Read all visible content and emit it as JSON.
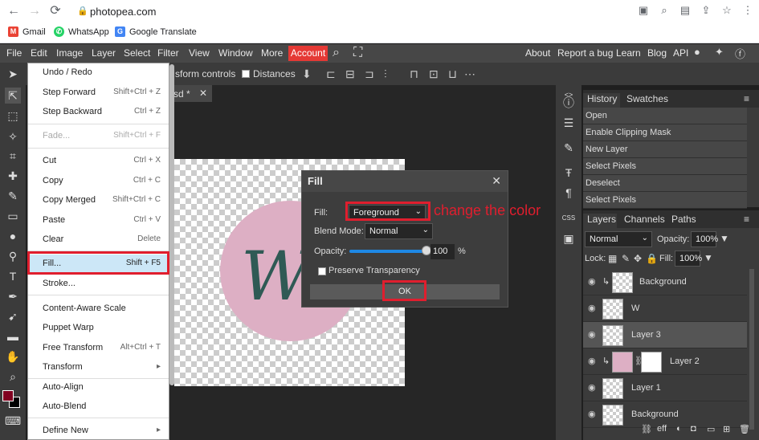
{
  "browser": {
    "url": "photopea.com",
    "bookmarks": [
      {
        "label": "Gmail",
        "icon": "gmail-icon"
      },
      {
        "label": "WhatsApp",
        "icon": "whatsapp-icon"
      },
      {
        "label": "Google Translate",
        "icon": "translate-icon"
      }
    ]
  },
  "menubar": {
    "items": [
      "File",
      "Edit",
      "Image",
      "Layer",
      "Select",
      "Filter",
      "View",
      "Window",
      "More"
    ],
    "account": "Account",
    "right_links": [
      "About",
      "Report a bug",
      "Learn",
      "Blog",
      "API"
    ]
  },
  "options": {
    "transform_controls": "sform controls",
    "distances": "Distances"
  },
  "doc_tab": {
    "name": "sd *",
    "close": "✕"
  },
  "edit_menu": {
    "items": [
      {
        "label": "Undo / Redo",
        "shortcut": "",
        "disabled": false
      },
      {
        "label": "Step Forward",
        "shortcut": "Shift+Ctrl + Z",
        "disabled": false
      },
      {
        "label": "Step Backward",
        "shortcut": "Ctrl + Z",
        "disabled": false
      },
      {
        "label": "Fade...",
        "shortcut": "Shift+Ctrl + F",
        "disabled": true
      },
      {
        "label": "Cut",
        "shortcut": "Ctrl + X",
        "disabled": false
      },
      {
        "label": "Copy",
        "shortcut": "Ctrl + C",
        "disabled": false
      },
      {
        "label": "Copy Merged",
        "shortcut": "Shift+Ctrl + C",
        "disabled": false
      },
      {
        "label": "Paste",
        "shortcut": "Ctrl + V",
        "disabled": false
      },
      {
        "label": "Clear",
        "shortcut": "Delete",
        "disabled": false
      },
      {
        "label": "Fill...",
        "shortcut": "Shift + F5",
        "disabled": false
      },
      {
        "label": "Stroke...",
        "shortcut": "",
        "disabled": false
      },
      {
        "label": "Content-Aware Scale",
        "shortcut": "",
        "disabled": false
      },
      {
        "label": "Puppet Warp",
        "shortcut": "",
        "disabled": false
      },
      {
        "label": "Free Transform",
        "shortcut": "Alt+Ctrl + T",
        "disabled": false
      },
      {
        "label": "Transform",
        "shortcut": "▸",
        "disabled": false
      },
      {
        "label": "Auto-Align",
        "shortcut": "",
        "disabled": false
      },
      {
        "label": "Auto-Blend",
        "shortcut": "",
        "disabled": false
      },
      {
        "label": "Define New",
        "shortcut": "▸",
        "disabled": false
      }
    ]
  },
  "fill_dialog": {
    "title": "Fill",
    "close": "✕",
    "fill_label": "Fill:",
    "fill_value": "Foreground",
    "blend_label": "Blend Mode:",
    "blend_value": "Normal",
    "opacity_label": "Opacity:",
    "opacity_value": "100",
    "opacity_unit": "%",
    "preserve_label": "Preserve Transparency",
    "ok": "OK",
    "annotation": "change the color"
  },
  "history": {
    "tabs": [
      "History",
      "Swatches"
    ],
    "items": [
      "Open",
      "Enable Clipping Mask",
      "New Layer",
      "Select Pixels",
      "Deselect",
      "Select Pixels"
    ]
  },
  "layers": {
    "tabs": [
      "Layers",
      "Channels",
      "Paths"
    ],
    "blend": "Normal",
    "opacity_label": "Opacity:",
    "opacity": "100%",
    "lock_label": "Lock:",
    "fill_label": "Fill:",
    "fill": "100%",
    "items": [
      "Background",
      "W",
      "Layer 3",
      "Layer 2",
      "Layer 1",
      "Background"
    ],
    "footer": [
      "eff"
    ]
  },
  "colors": {
    "foreground": "#800020",
    "accent_red": "#e01e2e",
    "account": "#e53935"
  },
  "canvas_letter": "W"
}
